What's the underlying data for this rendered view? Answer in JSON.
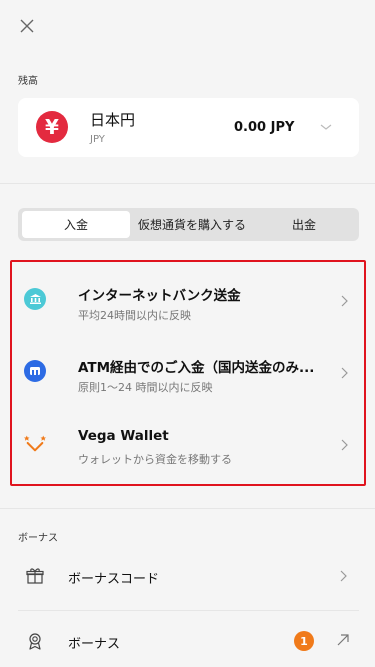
{
  "balance": {
    "section_label": "残高",
    "currency_name": "日本円",
    "currency_code": "JPY",
    "amount": "0.00 JPY",
    "icon": "yen-icon",
    "icon_color": "#e32a3f"
  },
  "tabs": [
    {
      "label": "入金",
      "active": true
    },
    {
      "label": "仮想通貨を購入する",
      "active": false
    },
    {
      "label": "出金",
      "active": false
    }
  ],
  "deposit_methods": [
    {
      "title": "インターネットバンク送金",
      "subtitle": "平均24時間以内に反映",
      "icon": "bank-icon",
      "icon_color": "#4cc9d6"
    },
    {
      "title": "ATM経由でのご入金（国内送金のみ...",
      "subtitle": "原則1〜24 時間以内に反映",
      "icon": "atm-card-icon",
      "icon_color": "#2d6be4"
    },
    {
      "title": "Vega Wallet",
      "subtitle": "ウォレットから資金を移動する",
      "icon": "vega-wallet-icon",
      "icon_color": "#f07a1a"
    }
  ],
  "bonus": {
    "section_label": "ボーナス",
    "items": [
      {
        "label": "ボーナスコード",
        "icon": "gift-icon"
      },
      {
        "label": "ボーナス",
        "icon": "award-icon",
        "badge": "1",
        "badge_color": "#f07a1a"
      }
    ]
  },
  "colors": {
    "highlight_border": "#e0141e",
    "background": "#f5f5f5"
  }
}
